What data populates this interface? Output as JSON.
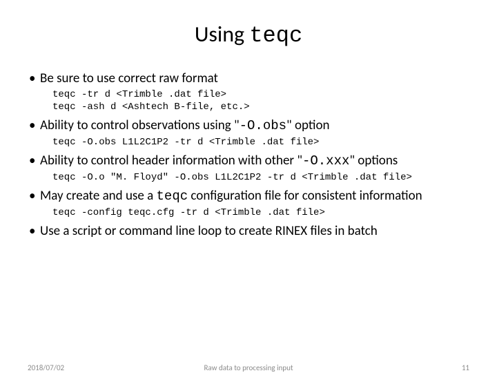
{
  "title_prefix": "Using ",
  "title_mono": "teqc",
  "bullets": {
    "b1": "Be sure to use correct raw format",
    "b1_code": "teqc -tr d <Trimble .dat file>\nteqc -ash d <Ashtech B-file, etc.>",
    "b2_pre": "Ability to control observations using \"",
    "b2_mono": "-O.obs",
    "b2_post": "\" option",
    "b2_code": "teqc -O.obs L1L2C1P2 -tr d <Trimble .dat file>",
    "b3_pre": "Ability to control header information with other \"",
    "b3_mono": "-O.xxx",
    "b3_post": "\" options",
    "b3_code": "teqc -O.o \"M. Floyd\" -O.obs L1L2C1P2 -tr d <Trimble .dat file>",
    "b4_pre": "May create and use a ",
    "b4_mono": "teqc",
    "b4_post": " configuration file for consistent information",
    "b4_code": "teqc -config teqc.cfg -tr d <Trimble .dat file>",
    "b5": "Use a script or command line loop to create RINEX files in batch"
  },
  "footer": {
    "date": "2018/07/02",
    "center": "Raw data to processing input",
    "page": "11"
  }
}
